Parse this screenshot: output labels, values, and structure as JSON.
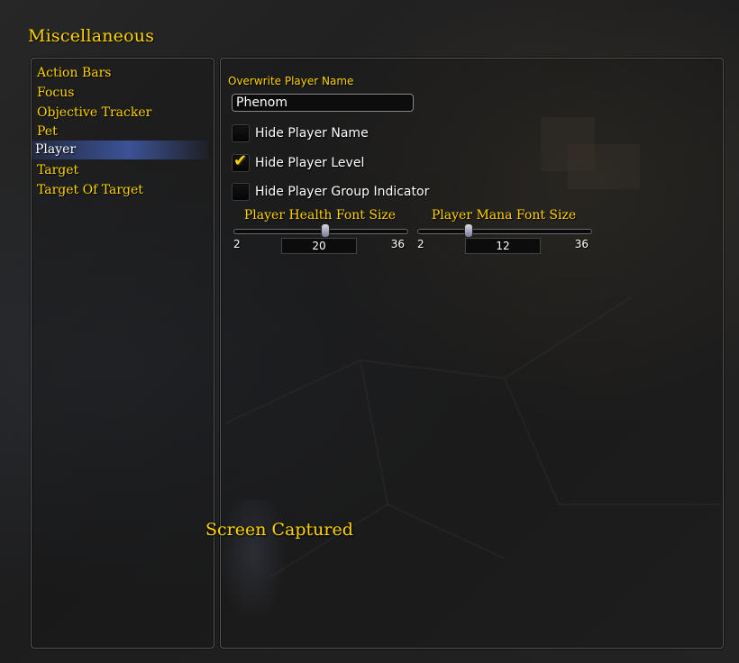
{
  "window": {
    "title": "Miscellaneous"
  },
  "sidebar": {
    "items": [
      {
        "label": "Action Bars",
        "selected": false
      },
      {
        "label": "Focus",
        "selected": false
      },
      {
        "label": "Objective Tracker",
        "selected": false
      },
      {
        "label": "Pet",
        "selected": false
      },
      {
        "label": "Player",
        "selected": true
      },
      {
        "label": "Target",
        "selected": false
      },
      {
        "label": "Target Of Target",
        "selected": false
      }
    ]
  },
  "player": {
    "overwrite_name": {
      "label": "Overwrite Player Name",
      "value": "Phenom"
    },
    "options": [
      {
        "label": "Hide Player Name",
        "checked": false
      },
      {
        "label": "Hide Player Level",
        "checked": true
      },
      {
        "label": "Hide Player Group Indicator",
        "checked": false
      }
    ],
    "sliders": [
      {
        "label": "Player Health Font Size",
        "min": "2",
        "max": "36",
        "value": "20"
      },
      {
        "label": "Player Mana Font Size",
        "min": "2",
        "max": "36",
        "value": "12"
      }
    ]
  },
  "notification": {
    "text": "Screen Captured"
  },
  "colors": {
    "accent_gold": "#ffd200",
    "selection_blue": "#4664be",
    "panel_border": "#5a5a5a"
  }
}
